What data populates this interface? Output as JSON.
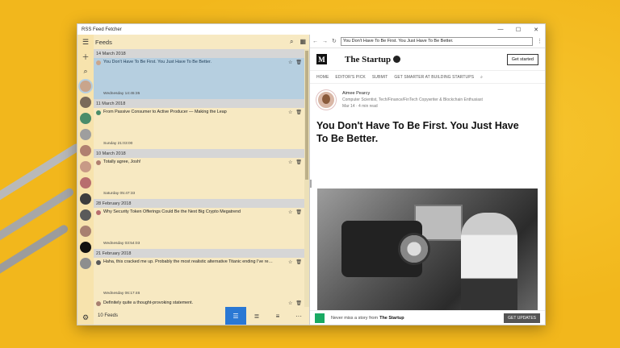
{
  "app_title": "RSS Feed Fetcher",
  "window_controls": {
    "minimize": "—",
    "maximize": "☐",
    "close": "✕"
  },
  "feeds_header": {
    "title": "Feeds"
  },
  "rail": {
    "avatars": [
      "#c9a58c",
      "#7a6a5a",
      "#4a8c6a",
      "#9e9e9e",
      "#b08070",
      "#c89a86",
      "#b86e6e",
      "#3d3d3d",
      "#5a5a5a",
      "#a88070",
      "#111111",
      "#8e8e8e"
    ]
  },
  "feed_groups": [
    {
      "date": "14 March 2018",
      "items": [
        {
          "title": "You Don't Have To Be First. You Just Have To Be Better.",
          "time": "Wednesday 14:45:35",
          "selected": true
        }
      ]
    },
    {
      "date": "11 March 2018",
      "items": [
        {
          "title": "From Passive Consumer to Active Producer — Making the Leap",
          "time": "Sunday 21:03:00"
        }
      ]
    },
    {
      "date": "10 March 2018",
      "items": [
        {
          "title": "Totally agree, Josh!",
          "time": "Saturday 05:47:33"
        }
      ]
    },
    {
      "date": "28 February 2018",
      "items": [
        {
          "title": "Why Security Token Offerings Could Be the Next Big Crypto Megatrend",
          "time": "Wednesday 03:54:03"
        }
      ]
    },
    {
      "date": "21 February 2018",
      "items": [
        {
          "title": "Haha, this cracked me up. Probably the most realistic alternative Titanic ending I've re…",
          "time": "Wednesday 06:17:46"
        },
        {
          "title": "Definitely quite a thought-provoking statement.",
          "time": ""
        }
      ]
    }
  ],
  "feed_footer": {
    "count": "10 Feeds",
    "more": "···"
  },
  "browser": {
    "url": "You Don't Have To Be First. You Just Have To Be Better.",
    "site": {
      "logo_letter": "M",
      "brand": "The Startup",
      "get_started": "Get started",
      "menu": [
        "HOME",
        "EDITOR'S PICK",
        "SUBMIT",
        "GET SMARTER AT BUILDING STARTUPS"
      ],
      "author_name": "Aimee Pearcy",
      "author_bio": "Computer Scientist, Tech/Finance/FinTech Copywriter & Blockchain Enthusiast",
      "meta": "Mar 14 · 4 min read",
      "headline": "You Don't Have To Be First. You Just Have To Be Better.",
      "promo_text": "Never miss a story from",
      "promo_brand": "The Startup",
      "promo_button": "GET UPDATES"
    }
  }
}
